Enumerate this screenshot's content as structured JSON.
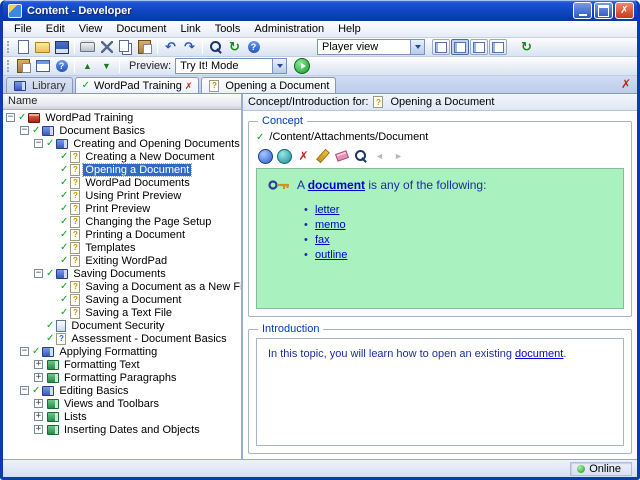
{
  "window": {
    "title": "Content - Developer"
  },
  "menu": {
    "items": [
      "File",
      "Edit",
      "View",
      "Document",
      "Link",
      "Tools",
      "Administration",
      "Help"
    ]
  },
  "toolbar_main": {
    "icons": [
      "new-document-icon",
      "open-folder-icon",
      "save-icon",
      "sep",
      "print-icon",
      "cut-icon",
      "copy-icon",
      "paste-icon",
      "sep",
      "undo-icon",
      "redo-icon",
      "sep",
      "find-icon",
      "refresh-icon",
      "help-icon"
    ],
    "player_view": "Player view",
    "view_toggles": [
      {
        "name": "layout-view-1-toggle",
        "pressed": false
      },
      {
        "name": "layout-view-2-toggle",
        "pressed": true
      },
      {
        "name": "layout-view-3-toggle",
        "pressed": false
      },
      {
        "name": "layout-view-4-toggle",
        "pressed": false
      }
    ]
  },
  "toolbar_preview": {
    "icons": [
      "clipboard-icon",
      "window-layout-icon",
      "help-icon",
      "sep",
      "move-up-icon",
      "move-down-icon",
      "sep"
    ],
    "label": "Preview:",
    "mode": "Try It! Mode"
  },
  "tabs": [
    {
      "label": "Library"
    },
    {
      "label": "WordPad Training"
    },
    {
      "label": "Opening a Document"
    }
  ],
  "tree": {
    "header": "Name",
    "items": [
      {
        "depth": 0,
        "expander": "minus",
        "check": true,
        "icon": "course",
        "label": "WordPad Training",
        "selected": false
      },
      {
        "depth": 1,
        "expander": "minus",
        "check": true,
        "icon": "book",
        "label": "Document Basics",
        "selected": false
      },
      {
        "depth": 2,
        "expander": "minus",
        "check": true,
        "icon": "book",
        "label": "Creating and Opening Documents",
        "selected": false
      },
      {
        "depth": 3,
        "expander": null,
        "check": true,
        "icon": "topic",
        "label": "Creating a New Document",
        "selected": false
      },
      {
        "depth": 3,
        "expander": null,
        "check": true,
        "icon": "topic",
        "label": "Opening a Document",
        "selected": true
      },
      {
        "depth": 3,
        "expander": null,
        "check": true,
        "icon": "topic",
        "label": "WordPad Documents",
        "selected": false
      },
      {
        "depth": 3,
        "expander": null,
        "check": true,
        "icon": "topic",
        "label": "Using Print Preview",
        "selected": false
      },
      {
        "depth": 3,
        "expander": null,
        "check": true,
        "icon": "topic",
        "label": "Print Preview",
        "selected": false
      },
      {
        "depth": 3,
        "expander": null,
        "check": true,
        "icon": "topic",
        "label": "Changing the Page Setup",
        "selected": false
      },
      {
        "depth": 3,
        "expander": null,
        "check": true,
        "icon": "topic",
        "label": "Printing a Document",
        "selected": false
      },
      {
        "depth": 3,
        "expander": null,
        "check": true,
        "icon": "topic",
        "label": "Templates",
        "selected": false
      },
      {
        "depth": 3,
        "expander": null,
        "check": true,
        "icon": "topic",
        "label": "Exiting WordPad",
        "selected": false
      },
      {
        "depth": 2,
        "expander": "minus",
        "check": true,
        "icon": "book",
        "label": "Saving Documents",
        "selected": false
      },
      {
        "depth": 3,
        "expander": null,
        "check": true,
        "icon": "topic",
        "label": "Saving a Document as a New File",
        "selected": false
      },
      {
        "depth": 3,
        "expander": null,
        "check": true,
        "icon": "topic",
        "label": "Saving a Document",
        "selected": false
      },
      {
        "depth": 3,
        "expander": null,
        "check": true,
        "icon": "topic",
        "label": "Saving a Text File",
        "selected": false
      },
      {
        "depth": 2,
        "expander": null,
        "check": true,
        "icon": "doc",
        "label": "Document Security",
        "selected": false
      },
      {
        "depth": 2,
        "expander": null,
        "check": true,
        "icon": "assessment",
        "label": "Assessment - Document Basics",
        "selected": false
      },
      {
        "depth": 1,
        "expander": "minus",
        "check": true,
        "icon": "book",
        "label": "Applying Formatting",
        "selected": false
      },
      {
        "depth": 2,
        "expander": "plus",
        "check": false,
        "icon": "chapter",
        "label": "Formatting Text",
        "selected": false
      },
      {
        "depth": 2,
        "expander": "plus",
        "check": false,
        "icon": "chapter",
        "label": "Formatting Paragraphs",
        "selected": false
      },
      {
        "depth": 1,
        "expander": "minus",
        "check": true,
        "icon": "book",
        "label": "Editing Basics",
        "selected": false
      },
      {
        "depth": 2,
        "expander": "plus",
        "check": false,
        "icon": "chapter",
        "label": "Views and Toolbars",
        "selected": false
      },
      {
        "depth": 2,
        "expander": "plus",
        "check": false,
        "icon": "chapter",
        "label": "Lists",
        "selected": false
      },
      {
        "depth": 2,
        "expander": "plus",
        "check": false,
        "icon": "chapter",
        "label": "Inserting Dates and Objects",
        "selected": false
      }
    ]
  },
  "content": {
    "header_label": "Concept/Introduction for:",
    "header_item": "Opening a Document",
    "concept": {
      "group_label": "Concept",
      "path": "/Content/Attachments/Document",
      "toolbar": [
        {
          "name": "link-icon",
          "disabled": false
        },
        {
          "name": "hyperlink-icon",
          "disabled": false
        },
        {
          "name": "remove-link-icon",
          "disabled": false
        },
        {
          "name": "edit-icon",
          "disabled": false
        },
        {
          "name": "erase-icon",
          "disabled": false
        },
        {
          "name": "preview-icon",
          "disabled": false
        },
        {
          "name": "back-icon",
          "disabled": true
        },
        {
          "name": "forward-icon",
          "disabled": true
        }
      ],
      "body_prefix": "A ",
      "body_link": "document",
      "body_suffix": " is any of the following:",
      "links": [
        "letter",
        "memo",
        "fax",
        "outline"
      ]
    },
    "introduction": {
      "group_label": "Introduction",
      "text_prefix": "In this topic, you will learn how to open an existing ",
      "text_link": "document",
      "text_suffix": "."
    }
  },
  "statusbar": {
    "online": "Online"
  },
  "colors": {
    "accent": "#316ac5",
    "concept_bg": "#a9f2bf",
    "link": "#0000cc",
    "check": "#00a818"
  }
}
